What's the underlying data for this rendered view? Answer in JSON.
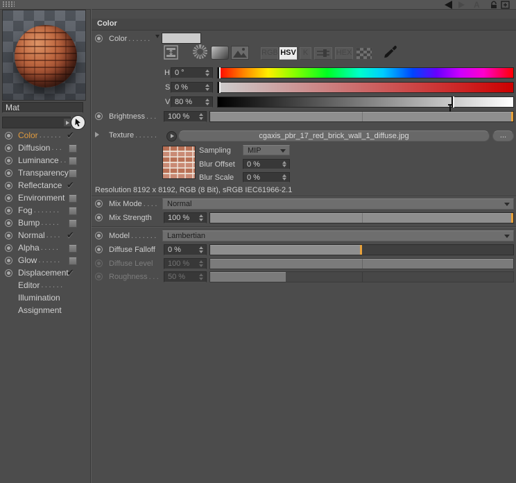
{
  "topbar": {
    "back": "back",
    "forward": "forward",
    "letter_a": "A"
  },
  "sidebar": {
    "material_name": "Mat",
    "channels": [
      {
        "id": "color",
        "label": "Color",
        "leader": "......",
        "state": "checked",
        "accent": true
      },
      {
        "id": "diffusion",
        "label": "Diffusion",
        "leader": "...",
        "state": "unchecked"
      },
      {
        "id": "luminance",
        "label": "Luminance",
        "leader": "..",
        "state": "unchecked"
      },
      {
        "id": "transparency",
        "label": "Transparency",
        "leader": "",
        "state": "unchecked"
      },
      {
        "id": "reflectance",
        "label": "Reflectance",
        "leader": "",
        "state": "checked"
      },
      {
        "id": "environment",
        "label": "Environment",
        "leader": "",
        "state": "unchecked"
      },
      {
        "id": "fog",
        "label": "Fog",
        "leader": ".......",
        "state": "unchecked"
      },
      {
        "id": "bump",
        "label": "Bump",
        "leader": ".....",
        "state": "unchecked"
      },
      {
        "id": "normal",
        "label": "Normal",
        "leader": "....",
        "state": "checked"
      },
      {
        "id": "alpha",
        "label": "Alpha",
        "leader": ".....",
        "state": "unchecked"
      },
      {
        "id": "glow",
        "label": "Glow",
        "leader": "......",
        "state": "unchecked"
      },
      {
        "id": "displacement",
        "label": "Displacement",
        "leader": "",
        "state": "checked"
      },
      {
        "id": "editor",
        "label": "Editor",
        "leader": "......",
        "state": "none"
      },
      {
        "id": "illumination",
        "label": "Illumination",
        "leader": "",
        "state": "none"
      },
      {
        "id": "assignment",
        "label": "Assignment",
        "leader": "",
        "state": "none"
      }
    ],
    "check_glyph": "✔"
  },
  "panel": {
    "header": "Color",
    "mode_buttons": {
      "rgb": "RGB",
      "hsv": "HSV",
      "k": "K",
      "hex": "HEX"
    },
    "hsv": {
      "h": {
        "letter": "H",
        "value": "0 °",
        "pos": 0
      },
      "s": {
        "letter": "S",
        "value": "0 %",
        "pos": 0
      },
      "v": {
        "letter": "V",
        "value": "80 %",
        "pos": 80
      }
    },
    "rows": {
      "color": {
        "label": "Color",
        "leader": "......",
        "swatch": "#cbcbcb"
      },
      "brightness": {
        "label": "Brightness",
        "leader": "...",
        "value": "100 %",
        "fill": 100
      },
      "texture": {
        "label": "Texture",
        "leader": "......",
        "filename": "cgaxis_pbr_17_red_brick_wall_1_diffuse.jpg",
        "browse": "...",
        "sampling_label": "Sampling",
        "sampling": "MIP",
        "blur_offset_label": "Blur Offset",
        "blur_offset": "0 %",
        "blur_scale_label": "Blur Scale",
        "blur_scale": "0 %",
        "resolution": "Resolution 8192 x 8192, RGB (8 Bit), sRGB IEC61966-2.1"
      },
      "mix_mode": {
        "label": "Mix Mode",
        "leader": "....",
        "value": "Normal"
      },
      "mix_strength": {
        "label": "Mix Strength",
        "leader": "",
        "value": "100 %",
        "fill": 100
      },
      "model": {
        "label": "Model",
        "leader": ".......",
        "value": "Lambertian"
      },
      "diffuse_falloff": {
        "label": "Diffuse Falloff",
        "leader": "",
        "value": "0 %",
        "fill": 50
      },
      "diffuse_level": {
        "label": "Diffuse Level",
        "leader": "",
        "value": "100 %",
        "fill": 100,
        "disabled": true
      },
      "roughness": {
        "label": "Roughness",
        "leader": "...",
        "value": "50 %",
        "fill": 25,
        "disabled": true
      }
    },
    "colors": {
      "accent_orange": "#e8a23c",
      "channel_label_orange": "#e09a3e",
      "swatch": "#cbcbcb"
    }
  }
}
